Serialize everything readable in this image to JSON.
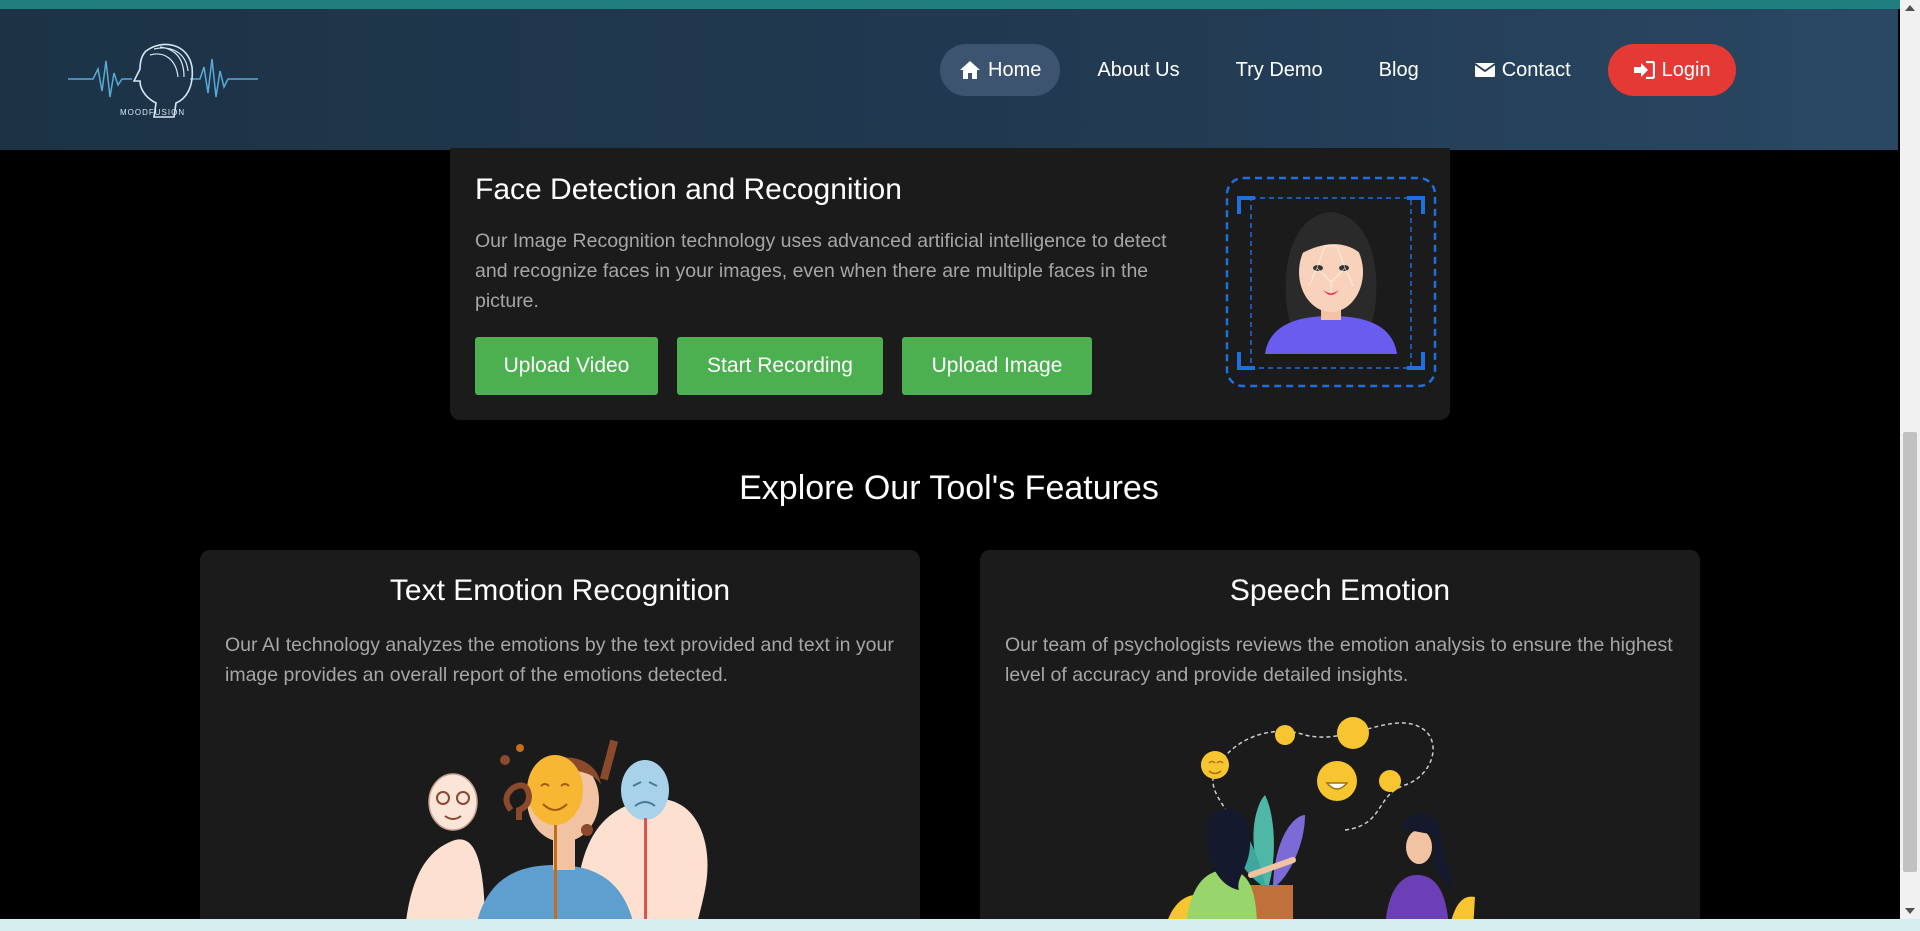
{
  "brand": {
    "logo_text": "MOODFUSION",
    "accent_color": "#4caf50",
    "login_color": "#e53935",
    "nav_bg": "#223a52"
  },
  "nav": {
    "items": [
      {
        "label": "Home",
        "icon": "home-icon",
        "active": true
      },
      {
        "label": "About Us"
      },
      {
        "label": "Try Demo"
      },
      {
        "label": "Blog"
      },
      {
        "label": "Contact",
        "icon": "envelope-icon"
      },
      {
        "label": "Login",
        "icon": "sign-in-icon"
      }
    ]
  },
  "face_section": {
    "title": "Face Detection and Recognition",
    "description": "Our Image Recognition technology uses advanced artificial intelligence to detect and recognize faces in your images, even when there are multiple faces in the picture.",
    "buttons": [
      "Upload Video",
      "Start Recording",
      "Upload Image"
    ]
  },
  "features": {
    "heading": "Explore Our Tool's Features",
    "cards": [
      {
        "title": "Text Emotion Recognition",
        "description": "Our AI technology analyzes the emotions by the text provided and text in your image provides an overall report of the emotions detected."
      },
      {
        "title": "Speech Emotion",
        "description": "Our team of psychologists reviews the emotion analysis to ensure the highest level of accuracy and provide detailed insights."
      }
    ]
  }
}
